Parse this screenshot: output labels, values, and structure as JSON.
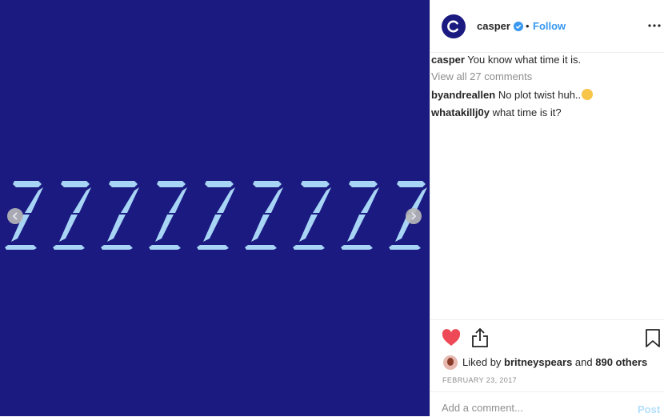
{
  "colors": {
    "media_bg": "#1a1a80",
    "z_color": "#a8d4f5",
    "link_blue": "#3897f0",
    "heart_red": "#ed4956",
    "muted": "#8e8e8e",
    "post_disabled": "#b2dffc"
  },
  "media": {
    "glyph": "Z",
    "glyph_count": 9,
    "prev_icon": "chevron-left-icon",
    "next_icon": "chevron-right-icon"
  },
  "header": {
    "username": "casper",
    "separator": "•",
    "follow_label": "Follow",
    "verified_icon": "verified-badge-icon",
    "more_icon": "more-options-icon"
  },
  "comments": {
    "caption_user": "casper",
    "caption_text": " You know what time it is.",
    "view_all": "View all 27 comments",
    "items": [
      {
        "user": "byandreallen",
        "text": " No plot twist huh.."
      },
      {
        "user": "whatakillj0y",
        "text": " what time is it?"
      }
    ]
  },
  "actions": {
    "liked_by_prefix": "Liked by ",
    "liked_by_user": "britneyspears",
    "liked_by_mid": " and ",
    "others": "890 others",
    "date": "FEBRUARY 23, 2017",
    "liked": true
  },
  "add_comment": {
    "placeholder": "Add a comment...",
    "post_label": "Post"
  }
}
